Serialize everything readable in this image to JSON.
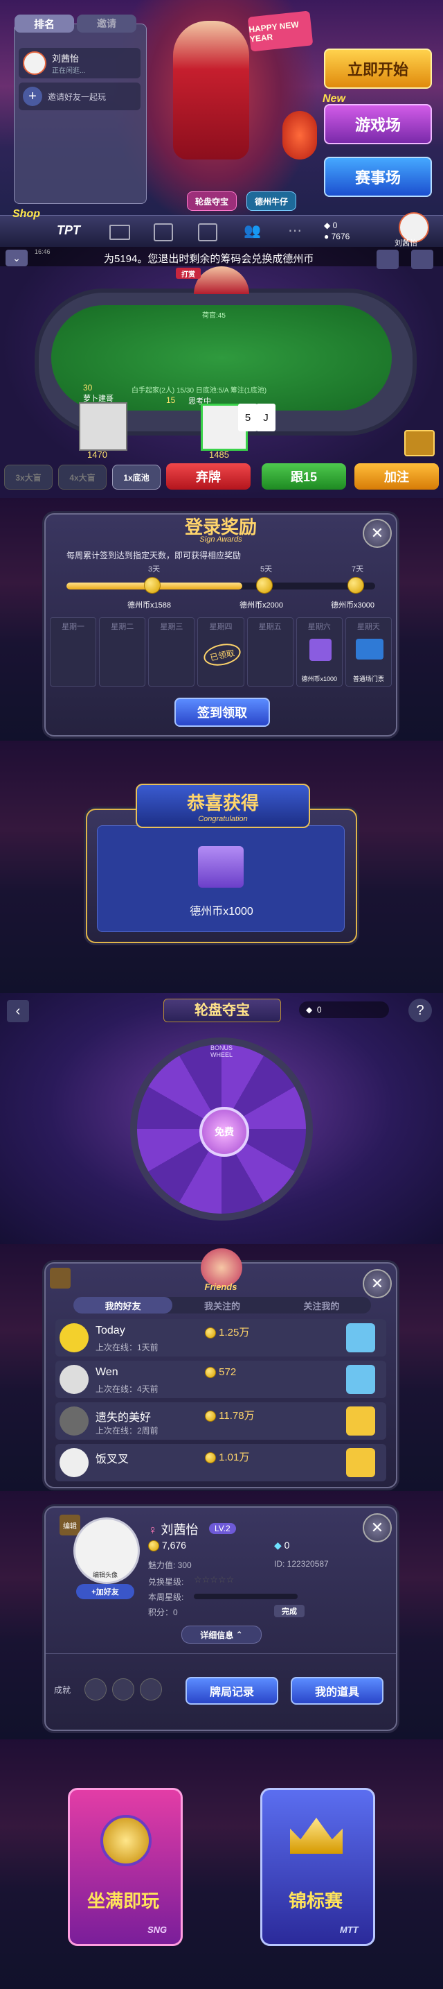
{
  "lobby": {
    "tabs": [
      "排名",
      "邀请"
    ],
    "friend_name": "刘茜怡",
    "friend_status": "正在闲逛...",
    "invite_text": "邀请好友一起玩",
    "banner_tag": "HAPPY NEW YEAR",
    "start_label": "立即开始",
    "new_badge": "New",
    "games_label": "游戏场",
    "events_label": "赛事场",
    "card_labels": [
      "轮盘夺宝",
      "德州牛仔"
    ],
    "shop_label": "Shop",
    "tpt_label": "TPT",
    "diamonds": "0",
    "coins": "7676",
    "username": "刘茜怡"
  },
  "table": {
    "marquee": "为5194。您退出时剩余的筹码会兑换成德州币",
    "time": "16:46",
    "dealer_tag": "打赏",
    "dealer_caption": "荷官:45",
    "blind_info": "白手起家(2人) 15/30 日底池:5/A 筹注(1底池)",
    "player1_name": "萝卜建哥",
    "player1_bet": "30",
    "player1_chips": "1470",
    "player2_name": "思考中",
    "player2_bet": "15",
    "player2_chips": "1485",
    "cards": [
      "5",
      "J"
    ],
    "pot_buttons": [
      "3x大盲",
      "4x大盲",
      "1x底池"
    ],
    "fold_label": "弃牌",
    "call_label": "跟15",
    "raise_label": "加注"
  },
  "sign": {
    "title": "登录奖励",
    "subtitle": "Sign Awards",
    "desc": "每周累计签到达到指定天数，即可获得相应奖励",
    "milestones": [
      {
        "day": "3天",
        "reward": "德州币x1588"
      },
      {
        "day": "5天",
        "reward": "德州币x2000"
      },
      {
        "day": "7天",
        "reward": "德州币x3000"
      }
    ],
    "progress": 0.57,
    "weekdays": [
      "星期一",
      "星期二",
      "星期三",
      "星期四",
      "星期五",
      "星期六",
      "星期天"
    ],
    "signed_tag": "已领取",
    "day6_reward": "德州币x1000",
    "day7_reward": "普通场门票",
    "claim_label": "签到领取"
  },
  "congrats": {
    "title": "恭喜获得",
    "subtitle": "Congratulation",
    "reward": "德州币x1000"
  },
  "wheel": {
    "title": "轮盘夺宝",
    "subtitle": "BONUS WHEEL",
    "diamonds": "0",
    "center_label": "免费",
    "help": "?"
  },
  "friends": {
    "title": "Friends",
    "tabs": [
      "我的好友",
      "我关注的",
      "关注我的"
    ],
    "list": [
      {
        "name": "Today",
        "last": "上次在线：1天前",
        "coins": "1.25万"
      },
      {
        "name": "Wen",
        "last": "上次在线：4天前",
        "coins": "572"
      },
      {
        "name": "遗失的美好",
        "last": "上次在线：2周前",
        "coins": "11.78万"
      },
      {
        "name": "饭叉叉",
        "last": "",
        "coins": "1.01万"
      }
    ]
  },
  "profile": {
    "edit_label": "编辑",
    "avatar_caption": "编辑头像",
    "follow_label": "+加好友",
    "name": "刘茜怡",
    "level": "LV.2",
    "coins": "7,676",
    "diamonds": "0",
    "charm": "魅力值: 300",
    "id": "ID: 122320587",
    "exchange_label": "兑换星级:",
    "week_label": "本周星级:",
    "score_label": "积分：0",
    "complete_label": "完成",
    "detail_label": "详细信息",
    "achieve_label": "成就",
    "records_label": "牌局记录",
    "props_label": "我的道具"
  },
  "modes": {
    "left_title": "坐满即玩",
    "left_tag": "SNG",
    "right_title": "锦标赛",
    "right_tag": "MTT"
  }
}
